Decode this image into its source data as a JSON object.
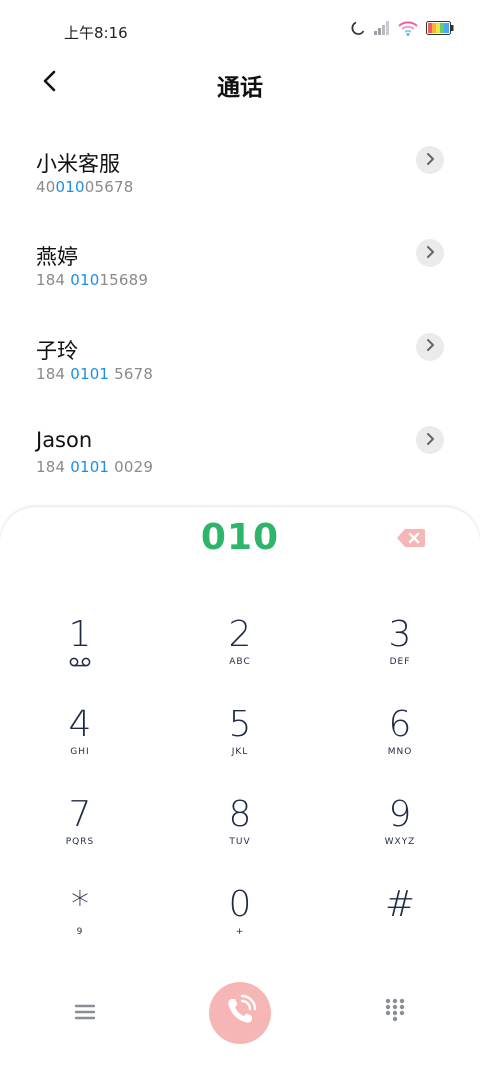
{
  "status_bar": {
    "time": "上午8:16",
    "icons": [
      "moon-icon",
      "signal-icon",
      "wifi-icon",
      "battery-icon"
    ]
  },
  "header": {
    "title": "通话",
    "back_icon": "back-arrow-icon"
  },
  "contacts": [
    {
      "name": "小米客服",
      "number_pre": "40",
      "number_hl": "010",
      "number_post": "05678"
    },
    {
      "name": "燕婷",
      "number_pre": "184 ",
      "number_hl": "010",
      "number_post": "15689"
    },
    {
      "name": "子玲",
      "number_pre": "184 ",
      "number_hl": "0101",
      "number_post": " 5678"
    },
    {
      "name": "Jason",
      "number_pre": "184 ",
      "number_hl": "0101",
      "number_post": " 0029"
    }
  ],
  "dialer": {
    "input": "010",
    "keys": [
      {
        "digit": "1",
        "letters": "∞"
      },
      {
        "digit": "2",
        "letters": "ABC"
      },
      {
        "digit": "3",
        "letters": "DEF"
      },
      {
        "digit": "4",
        "letters": "GHI"
      },
      {
        "digit": "5",
        "letters": "JKL"
      },
      {
        "digit": "6",
        "letters": "MNO"
      },
      {
        "digit": "7",
        "letters": "PQRS"
      },
      {
        "digit": "8",
        "letters": "TUV"
      },
      {
        "digit": "9",
        "letters": "WXYZ"
      },
      {
        "digit": "*",
        "letters": "9"
      },
      {
        "digit": "0",
        "letters": "+"
      },
      {
        "digit": "#",
        "letters": ""
      }
    ]
  },
  "colors": {
    "accent_green": "#2db56a",
    "highlight_blue": "#1a8ee8",
    "call_button": "#f7b6b6",
    "delete_icon": "#f7b6b6"
  }
}
